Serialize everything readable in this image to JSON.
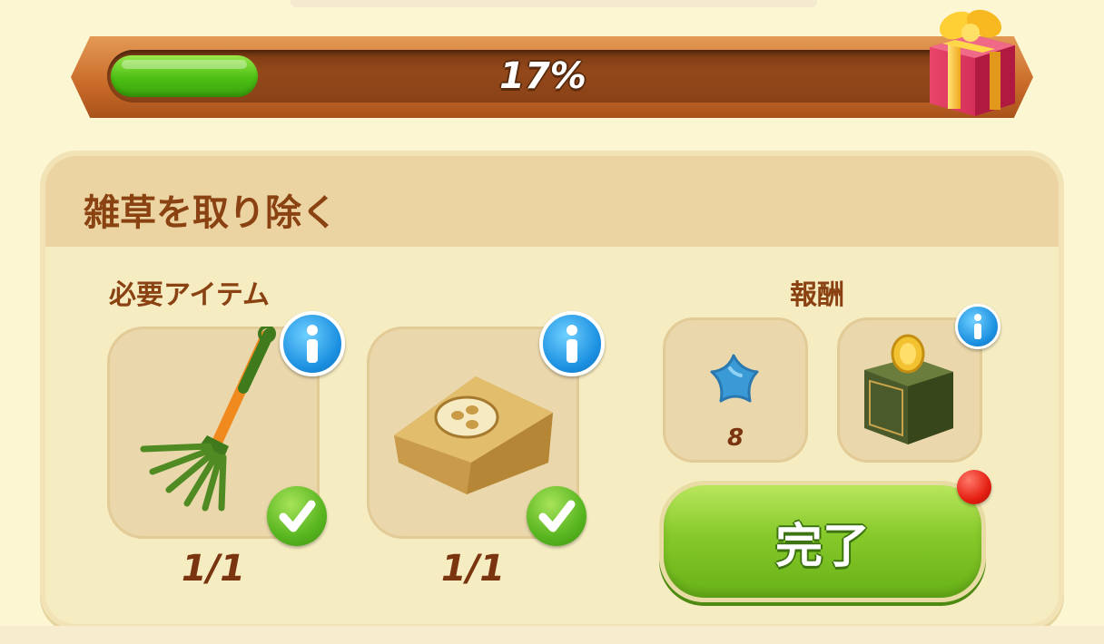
{
  "progress": {
    "percent_text": "17%",
    "fraction": 0.17,
    "fill_color": "#4cbf14"
  },
  "task": {
    "title": "雑草を取り除く"
  },
  "required": {
    "label": "必要アイテム",
    "items": [
      {
        "name": "rake",
        "count": "1/1",
        "completed": true
      },
      {
        "name": "seed-bag",
        "count": "1/1",
        "completed": true
      }
    ]
  },
  "rewards": {
    "label": "報酬",
    "items": [
      {
        "name": "blue-star",
        "quantity": "8"
      },
      {
        "name": "coin-box"
      }
    ]
  },
  "complete_button": {
    "label": "完了"
  },
  "icons": [
    "gift-icon",
    "info-icon",
    "check-icon",
    "rake-icon",
    "seed-bag-icon",
    "blue-star-icon",
    "coin-box-icon"
  ]
}
